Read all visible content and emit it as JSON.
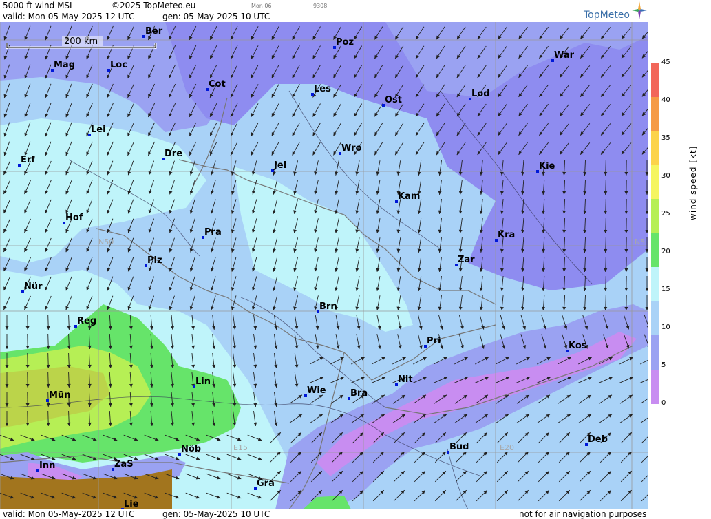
{
  "header": {
    "product": "5000 ft wind MSL",
    "copyright": "©2025 TopMeteo.eu",
    "day_label": "Mon 06",
    "code": "9308",
    "valid": "valid:  Mon  05-May-2025  12 UTC",
    "gen": "gen:  05-May-2025 10 UTC",
    "brand": "TopMeteo"
  },
  "footer": {
    "valid": "valid:  Mon  05-May-2025  12 UTC",
    "gen": "gen:  05-May-2025 10 UTC",
    "disclaimer": "not for air navigation purposes"
  },
  "map": {
    "scale_label": "200 km",
    "grid_labels": {
      "n50": "N50",
      "n50_right": "N5",
      "e15": "E15",
      "e20": "E20"
    },
    "cities": [
      {
        "name": "Ber"
      },
      {
        "name": "Poz"
      },
      {
        "name": "War"
      },
      {
        "name": "Mag"
      },
      {
        "name": "Loc"
      },
      {
        "name": "Cot"
      },
      {
        "name": "Les"
      },
      {
        "name": "Ost"
      },
      {
        "name": "Lod"
      },
      {
        "name": "Lei"
      },
      {
        "name": "Erf"
      },
      {
        "name": "Dre"
      },
      {
        "name": "Wro"
      },
      {
        "name": "Jel"
      },
      {
        "name": "Kie"
      },
      {
        "name": "Kam"
      },
      {
        "name": "Hof"
      },
      {
        "name": "Pra"
      },
      {
        "name": "Kra"
      },
      {
        "name": "Zar"
      },
      {
        "name": "Plz"
      },
      {
        "name": "Nür"
      },
      {
        "name": "Brn"
      },
      {
        "name": "Reg"
      },
      {
        "name": "Pri"
      },
      {
        "name": "Kos"
      },
      {
        "name": "Lin"
      },
      {
        "name": "Nit"
      },
      {
        "name": "Mün"
      },
      {
        "name": "Wie"
      },
      {
        "name": "Bra"
      },
      {
        "name": "Deb"
      },
      {
        "name": "Nöb"
      },
      {
        "name": "Bud"
      },
      {
        "name": "Inn"
      },
      {
        "name": "ZaS"
      },
      {
        "name": "Gra"
      },
      {
        "name": "Lie"
      }
    ]
  },
  "legend": {
    "title": "wind  speed  [kt]",
    "ticks": [
      "45",
      "40",
      "35",
      "30",
      "25",
      "20",
      "15",
      "10",
      "5",
      "0"
    ],
    "colors": [
      "#f2665a",
      "#f59a45",
      "#fcd34a",
      "#f5f560",
      "#b6ef55",
      "#66e46a",
      "#bff4fa",
      "#a9d2f7",
      "#9aa2f2",
      "#c88df1"
    ]
  }
}
